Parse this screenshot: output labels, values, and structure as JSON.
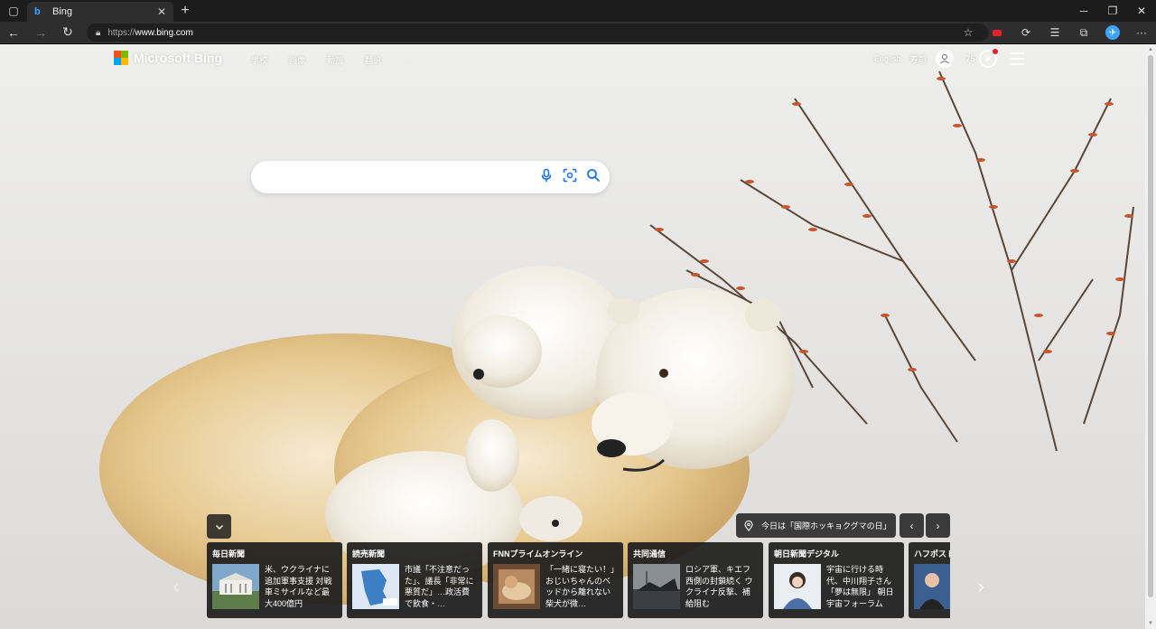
{
  "tab": {
    "title": "Bing",
    "favicon": "bing-icon"
  },
  "address": {
    "scheme": "https://",
    "host": "www.bing.com"
  },
  "header": {
    "logo_text": "Microsoft Bing",
    "nav": [
      "学校",
      "画像",
      "動画",
      "翻訳",
      "···"
    ],
    "language": "English",
    "user_name": "寿司",
    "rewards_points": "75"
  },
  "search": {
    "value": ""
  },
  "news": {
    "today_label": "今日は「国際ホッキョクグマの日」",
    "cards": [
      {
        "source": "毎日新聞",
        "headline": "米、ウクライナに追加軍事支援 対戦車ミサイルなど最大400億円"
      },
      {
        "source": "読売新聞",
        "headline": "市議「不注意だった」、議長「非常に悪質だ」…政活費で飲食・…"
      },
      {
        "source": "FNNプライムオンライン",
        "headline": "「一緒に寝たい！」おじいちゃんのベッドから離れない柴犬が微…"
      },
      {
        "source": "共同通信",
        "headline": "ロシア軍、キエフ西側の封鎖続く ウクライナ反撃、補給阻む"
      },
      {
        "source": "朝日新聞デジタル",
        "headline": "宇宙に行ける時代、中川翔子さん「夢は無限」 朝日宇宙フォーラム"
      },
      {
        "source": "ハフポスト",
        "headline": ""
      }
    ]
  },
  "colors": {
    "accent": "#0078d4",
    "tab_bg": "#1c1c1c",
    "toolbar_bg": "#2e2e2e"
  }
}
